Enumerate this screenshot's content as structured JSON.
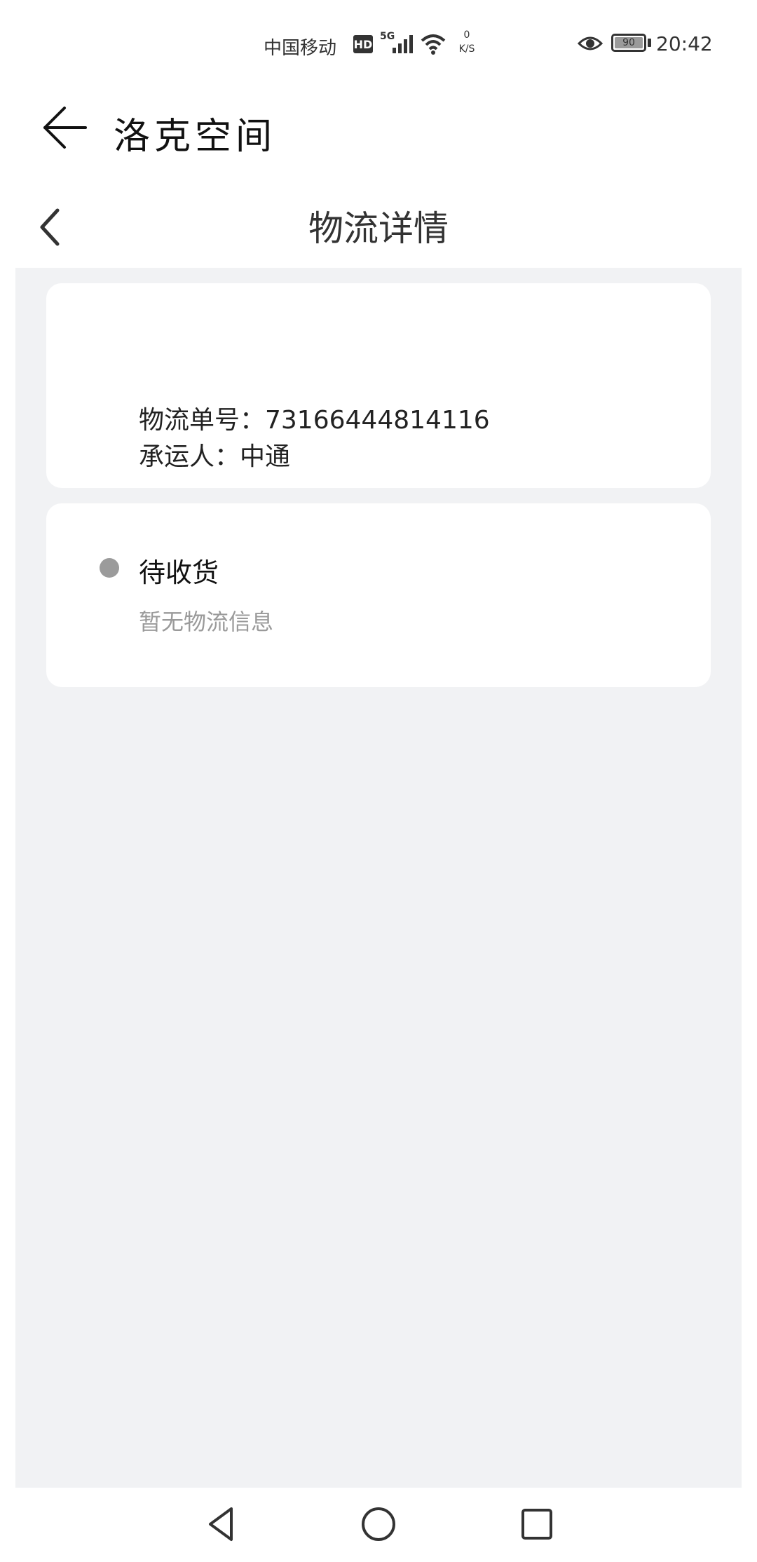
{
  "status_bar": {
    "carrier": "中国移动",
    "hd": "HD",
    "network": "5G",
    "speed_value": "0",
    "speed_unit": "K/S",
    "battery": "90",
    "time": "20:42"
  },
  "app_header": {
    "title": "洛克空间"
  },
  "page_header": {
    "title": "物流详情"
  },
  "shipment": {
    "tracking_line": "物流单号：73166444814116",
    "carrier_line": "承运人：中通"
  },
  "status": {
    "title": "待收货",
    "message": "暂无物流信息"
  },
  "colors": {
    "background": "#f1f2f4",
    "card": "#ffffff",
    "dot": "#9b9b9b",
    "secondary_text": "#9a9a9a"
  }
}
